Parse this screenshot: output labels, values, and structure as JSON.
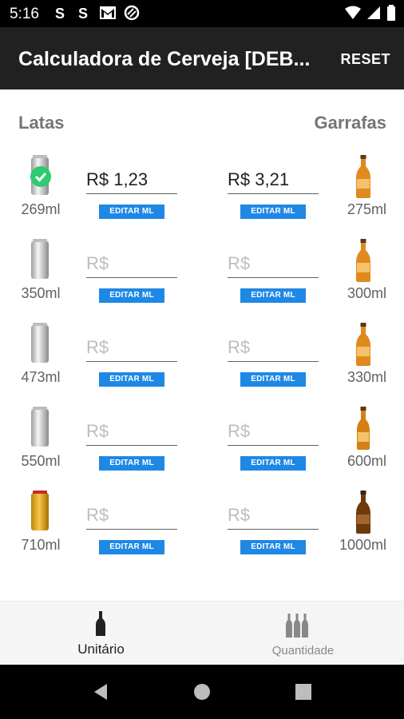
{
  "status_bar": {
    "time": "5:16",
    "icons": [
      "s-app-icon",
      "s-app-icon",
      "gmail-icon",
      "no-disturb-icon"
    ],
    "right_icons": [
      "wifi-icon",
      "signal-icon",
      "battery-icon"
    ]
  },
  "app_bar": {
    "title": "Calculadora de Cerveja [DEB...",
    "reset_label": "RESET"
  },
  "headers": {
    "left": "Latas",
    "right": "Garrafas"
  },
  "rows": [
    {
      "can": {
        "volume": "269ml",
        "price_value": "R$ 1,23",
        "placeholder": "R$",
        "edit_label": "EDITAR ML",
        "selected": true
      },
      "bottle": {
        "volume": "275ml",
        "price_value": "R$ 3,21",
        "placeholder": "R$",
        "edit_label": "EDITAR ML"
      }
    },
    {
      "can": {
        "volume": "350ml",
        "price_value": "",
        "placeholder": "R$",
        "edit_label": "EDITAR ML"
      },
      "bottle": {
        "volume": "300ml",
        "price_value": "",
        "placeholder": "R$",
        "edit_label": "EDITAR ML"
      }
    },
    {
      "can": {
        "volume": "473ml",
        "price_value": "",
        "placeholder": "R$",
        "edit_label": "EDITAR ML"
      },
      "bottle": {
        "volume": "330ml",
        "price_value": "",
        "placeholder": "R$",
        "edit_label": "EDITAR ML"
      }
    },
    {
      "can": {
        "volume": "550ml",
        "price_value": "",
        "placeholder": "R$",
        "edit_label": "EDITAR ML"
      },
      "bottle": {
        "volume": "600ml",
        "price_value": "",
        "placeholder": "R$",
        "edit_label": "EDITAR ML"
      }
    },
    {
      "can": {
        "volume": "710ml",
        "price_value": "",
        "placeholder": "R$",
        "edit_label": "EDITAR ML"
      },
      "bottle": {
        "volume": "1000ml",
        "price_value": "",
        "placeholder": "R$",
        "edit_label": "EDITAR ML"
      }
    }
  ],
  "bottom_nav": {
    "items": [
      {
        "label": "Unitário",
        "icon": "single-bottle-icon",
        "active": true
      },
      {
        "label": "Quantidade",
        "icon": "multiple-bottles-icon",
        "active": false
      }
    ]
  },
  "colors": {
    "app_bar": "#212121",
    "accent_button": "#1e88e5",
    "check_badge": "#2ecc71",
    "header_text": "#757575"
  }
}
